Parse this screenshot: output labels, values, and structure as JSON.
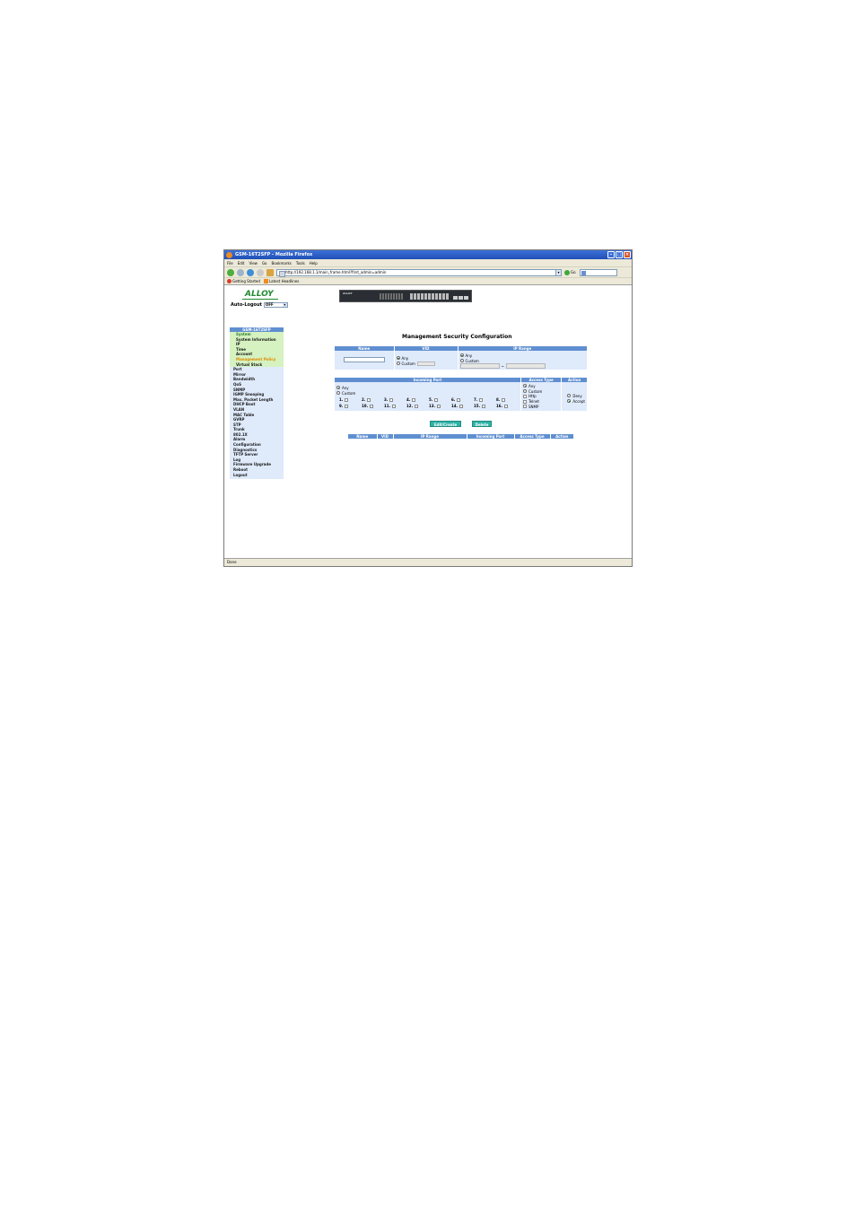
{
  "browser": {
    "title": "GSM-16T2SFP - Mozilla Firefox",
    "menu": [
      "File",
      "Edit",
      "View",
      "Go",
      "Bookmarks",
      "Tools",
      "Help"
    ],
    "url": "http://192.168.1.1/main_frame.html?first_admin=admin",
    "go_label": "Go",
    "bookmarks": [
      "Getting Started",
      "Latest Headlines"
    ],
    "status": "Done"
  },
  "header": {
    "logo": "ALLOY",
    "autologout_label": "Auto-Logout",
    "autologout_value": "OFF"
  },
  "sidebar": {
    "heading": "GSM-16T2SFP",
    "subitems": [
      "System",
      "System Information",
      "IP",
      "Time",
      "Account",
      "Management Policy",
      "Virtual Stack"
    ],
    "items": [
      "Port",
      "Mirror",
      "Bandwidth",
      "QoS",
      "SNMP",
      "IGMP Snooping",
      "Max. Packet Length",
      "DHCP Boot",
      "VLAN",
      "MAC Table",
      "GVRP",
      "STP",
      "Trunk",
      "802.1X",
      "Alarm",
      "Configuration",
      "Diagnostics",
      "TFTP Server",
      "Log",
      "Firmware Upgrade",
      "Reboot",
      "Logout"
    ]
  },
  "main": {
    "title": "Management Security Configuration",
    "table1": {
      "headers": [
        "Name",
        "VID",
        "IP Range"
      ],
      "vid_any": "Any",
      "vid_custom": "Custom",
      "ip_any": "Any",
      "ip_custom": "Custom",
      "range_sep": "~"
    },
    "table2": {
      "headers": [
        "Incoming Port",
        "Access Type",
        "Action"
      ],
      "port_any": "Any",
      "port_custom": "Custom",
      "ports": [
        "1.",
        "2.",
        "3.",
        "4.",
        "5.",
        "6.",
        "7.",
        "8.",
        "9.",
        "10.",
        "11.",
        "12.",
        "13.",
        "14.",
        "15.",
        "16."
      ],
      "access_any": "Any",
      "access_custom": "Custom",
      "access_types": [
        "Http",
        "Telnet",
        "SNMP"
      ],
      "action_deny": "Deny",
      "action_accept": "Accept"
    },
    "buttons": {
      "edit": "Edit/Create",
      "delete": "Delete"
    },
    "list_headers": [
      "Name",
      "VID",
      "IP Range",
      "Incoming Port",
      "Access Type",
      "Action"
    ]
  }
}
